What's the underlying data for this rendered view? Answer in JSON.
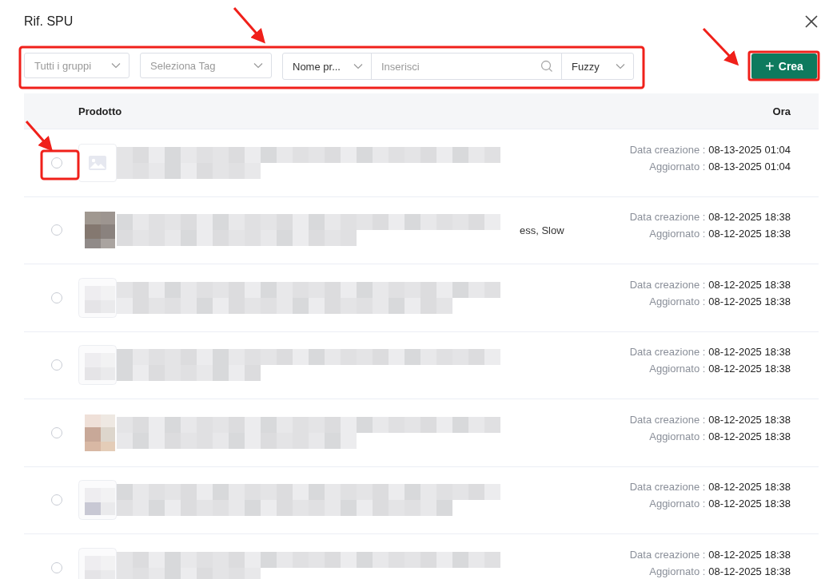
{
  "dialog": {
    "title": "Rif. SPU"
  },
  "filters": {
    "group": {
      "placeholder": "Tutti i gruppi"
    },
    "tag": {
      "placeholder": "Seleziona Tag"
    },
    "field": {
      "value": "Nome pr..."
    },
    "search": {
      "placeholder": "Inserisci"
    },
    "mode": {
      "value": "Fuzzy"
    }
  },
  "create_button": {
    "icon": "+",
    "label": "Crea"
  },
  "table": {
    "columns": [
      "Prodotto",
      "Ora"
    ],
    "rows": [
      {
        "selected": false,
        "thumbnail": {
          "kind": "placeholder"
        },
        "created_label": "Data creazione :",
        "created": "08-13-2025 01:04",
        "updated_label": "Aggiornato :",
        "updated": "08-13-2025 01:04"
      },
      {
        "selected": false,
        "text_fragment": "ess, Slow",
        "created_label": "Data creazione :",
        "created": "08-12-2025 18:38",
        "updated_label": "Aggiornato :",
        "updated": "08-12-2025 18:38"
      },
      {
        "selected": false,
        "thumbnail": {
          "kind": "blurred"
        },
        "created_label": "Data creazione :",
        "created": "08-12-2025 18:38",
        "updated_label": "Aggiornato :",
        "updated": "08-12-2025 18:38"
      },
      {
        "selected": false,
        "thumbnail": {
          "kind": "blurred"
        },
        "created_label": "Data creazione :",
        "created": "08-12-2025 18:38",
        "updated_label": "Aggiornato :",
        "updated": "08-12-2025 18:38"
      },
      {
        "selected": false,
        "created_label": "Data creazione :",
        "created": "08-12-2025 18:38",
        "updated_label": "Aggiornato :",
        "updated": "08-12-2025 18:38"
      },
      {
        "selected": false,
        "thumbnail": {
          "kind": "blurred"
        },
        "created_label": "Data creazione :",
        "created": "08-12-2025 18:38",
        "updated_label": "Aggiornato :",
        "updated": "08-12-2025 18:38"
      },
      {
        "selected": false,
        "thumbnail": {
          "kind": "blurred"
        },
        "created_label": "Data creazione :",
        "created": "08-12-2025 18:38",
        "updated_label": "Aggiornato :",
        "updated": "08-12-2025 18:38"
      }
    ]
  }
}
